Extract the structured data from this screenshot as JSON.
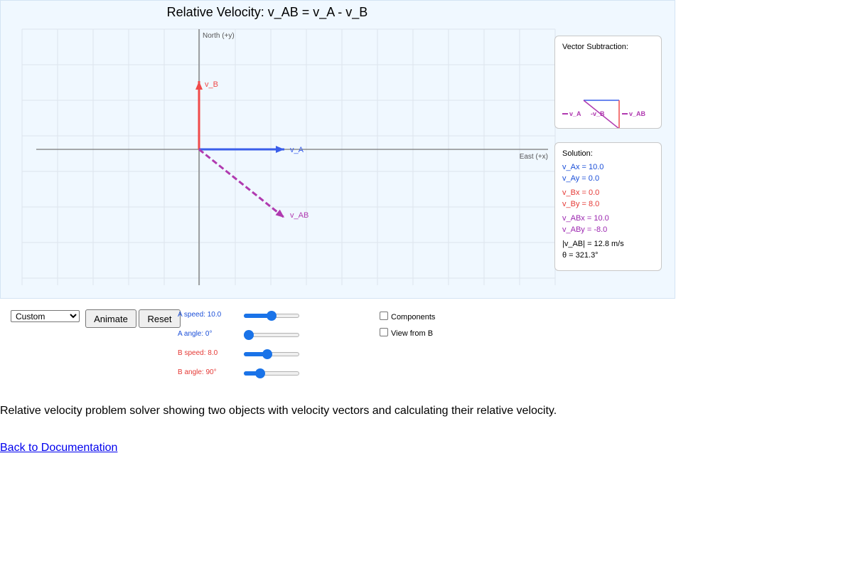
{
  "title": "Relative Velocity: v_AB = v_A - v_B",
  "axes": {
    "y_label": "North (+y)",
    "x_label": "East (+x)"
  },
  "vectors": {
    "A": {
      "label": "v_A",
      "color": "#3a5eea",
      "x": 10.0,
      "y": 0.0
    },
    "B": {
      "label": "v_B",
      "color": "#f04a4a",
      "x": 0.0,
      "y": 8.0
    },
    "AB": {
      "label": "v_AB",
      "color": "#b03ab0",
      "x": 10.0,
      "y": -8.0
    }
  },
  "subtraction_panel": {
    "heading": "Vector Subtraction:",
    "legend": [
      "v_A",
      "-v_B",
      "v_AB"
    ]
  },
  "solution": {
    "heading": "Solution:",
    "lines": [
      {
        "text": "v_Ax = 10.0",
        "color": "#1a4ed8"
      },
      {
        "text": "v_Ay = 0.0",
        "color": "#1a4ed8"
      },
      {
        "text": "v_Bx = 0.0",
        "color": "#e53935"
      },
      {
        "text": "v_By = 8.0",
        "color": "#e53935"
      },
      {
        "text": "v_ABx = 10.0",
        "color": "#9c27b0"
      },
      {
        "text": "v_ABy = -8.0",
        "color": "#9c27b0"
      },
      {
        "text": "|v_AB| = 12.8 m/s",
        "color": "#000000"
      },
      {
        "text": "θ = 321.3°",
        "color": "#000000"
      }
    ]
  },
  "controls": {
    "preset": {
      "selected": "Custom"
    },
    "animate_label": "Animate",
    "reset_label": "Reset",
    "sliders": [
      {
        "label": "A speed: 10.0",
        "color": "#1a4ed8",
        "fraction": 0.5
      },
      {
        "label": "A angle: 0°",
        "color": "#1a4ed8",
        "fraction": 0.0
      },
      {
        "label": "B speed: 8.0",
        "color": "#e53935",
        "fraction": 0.4
      },
      {
        "label": "B angle: 90°",
        "color": "#e53935",
        "fraction": 0.25
      }
    ],
    "checkboxes": [
      {
        "label": "Components",
        "checked": false
      },
      {
        "label": "View from B",
        "checked": false
      }
    ]
  },
  "description": "Relative velocity problem solver showing two objects with velocity vectors and calculating their relative velocity.",
  "back_link": "Back to Documentation"
}
